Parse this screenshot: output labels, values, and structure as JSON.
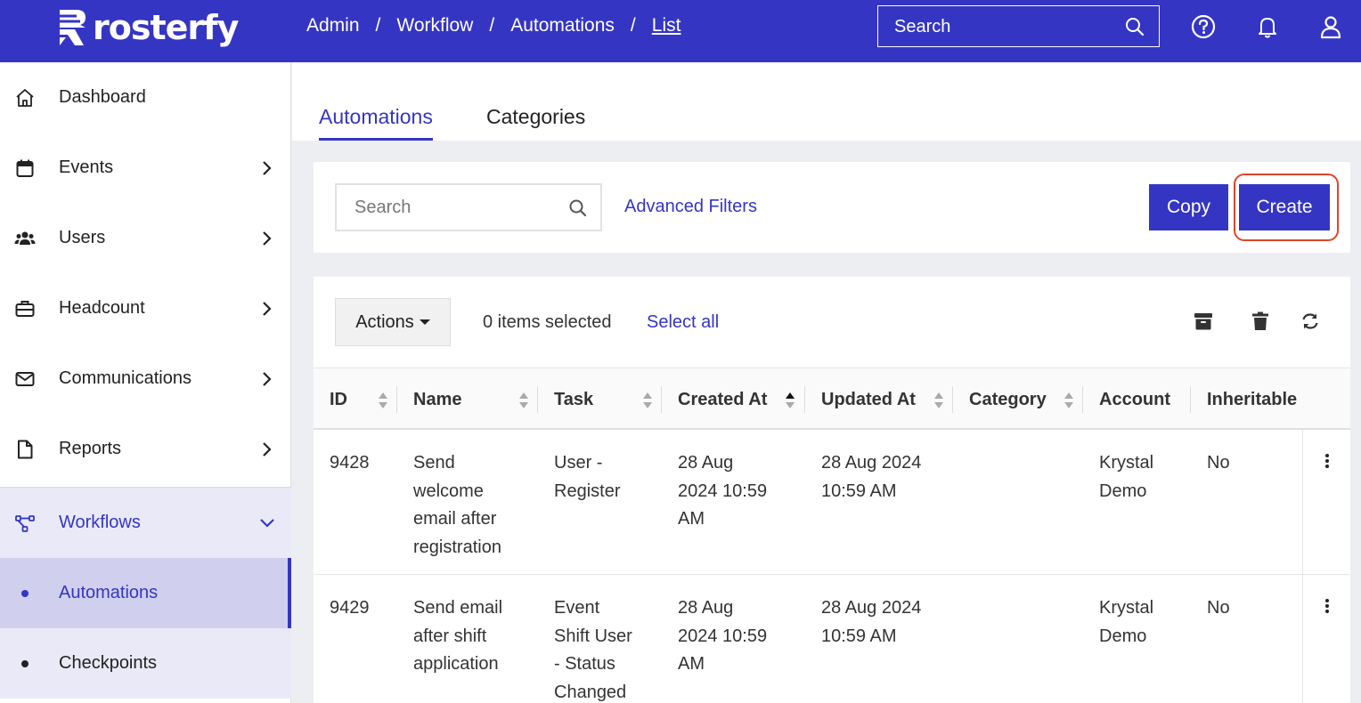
{
  "brand": {
    "name": "rosterfy"
  },
  "breadcrumb": {
    "items": [
      "Admin",
      "Workflow",
      "Automations"
    ],
    "current": "List",
    "separator": "/"
  },
  "topbar": {
    "search_placeholder": "Search"
  },
  "sidebar": {
    "items": [
      {
        "label": "Dashboard",
        "icon": "home-icon"
      },
      {
        "label": "Events",
        "icon": "calendar-icon"
      },
      {
        "label": "Users",
        "icon": "users-icon"
      },
      {
        "label": "Headcount",
        "icon": "briefcase-icon"
      },
      {
        "label": "Communications",
        "icon": "envelope-icon"
      },
      {
        "label": "Reports",
        "icon": "document-icon"
      },
      {
        "label": "Workflows",
        "icon": "workflow-icon"
      }
    ],
    "sub_items": [
      {
        "label": "Automations",
        "active": true
      },
      {
        "label": "Checkpoints",
        "active": false
      }
    ]
  },
  "tabs": [
    {
      "label": "Automations",
      "active": true
    },
    {
      "label": "Categories",
      "active": false
    }
  ],
  "filters": {
    "search_placeholder": "Search",
    "advanced_label": "Advanced Filters",
    "copy_label": "Copy",
    "create_label": "Create"
  },
  "toolbar": {
    "actions_label": "Actions",
    "selected_text": "0 items selected",
    "select_all_label": "Select all"
  },
  "table": {
    "columns": [
      "ID",
      "Name",
      "Task",
      "Created At",
      "Updated At",
      "Category",
      "Account",
      "Inheritable"
    ],
    "rows": [
      {
        "id": "9428",
        "name": [
          "Send",
          "welcome",
          "email after",
          "registration"
        ],
        "task": [
          "User -",
          "Register"
        ],
        "created": [
          "28 Aug",
          "2024 10:59",
          "AM"
        ],
        "updated": [
          "28 Aug 2024",
          "10:59 AM"
        ],
        "category": "",
        "account": [
          "Krystal",
          "Demo"
        ],
        "inheritable": "No"
      },
      {
        "id": "9429",
        "name": [
          "Send email",
          "after shift",
          "application"
        ],
        "task": [
          "Event",
          "Shift User",
          "- Status",
          "Changed"
        ],
        "created": [
          "28 Aug",
          "2024 10:59",
          "AM"
        ],
        "updated": [
          "28 Aug 2024",
          "10:59 AM"
        ],
        "category": "",
        "account": [
          "Krystal",
          "Demo"
        ],
        "inheritable": "No"
      }
    ]
  },
  "colors": {
    "primary": "#3535c4",
    "highlight": "#e0442a"
  }
}
